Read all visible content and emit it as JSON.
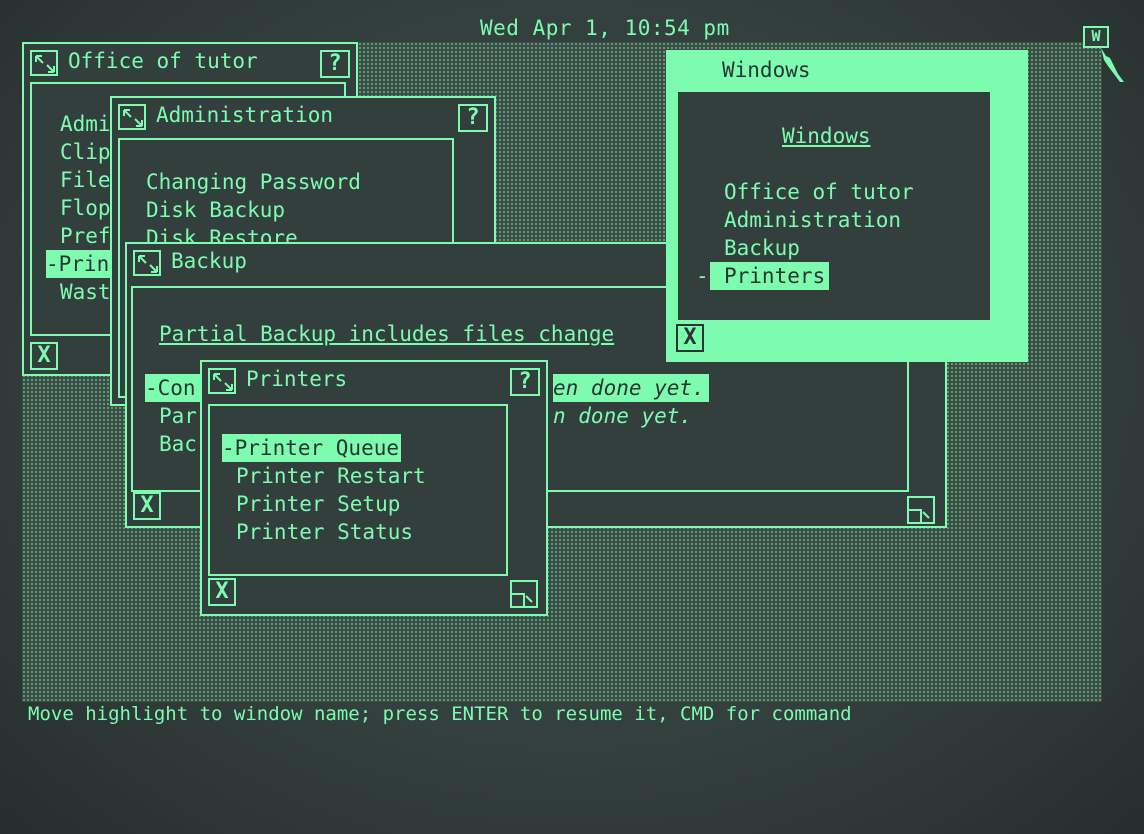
{
  "clock": "Wed Apr 1, 10:54 pm",
  "app_icon": "W",
  "status_line": "Move highlight to window name; press ENTER to resume it, CMD for command",
  "windows": {
    "office": {
      "title": "Office of tutor",
      "help": "?",
      "close": "X",
      "items": [
        "Admi",
        "Clip",
        "File",
        "Flop",
        "Pref",
        "-Prin",
        "Wast"
      ],
      "selected_index": 5
    },
    "administration": {
      "title": "Administration",
      "help": "?",
      "items": [
        "Changing Password",
        "Disk Backup",
        "Disk Restore"
      ]
    },
    "backup": {
      "title": "Backup",
      "close": "X",
      "heading": "Partial Backup includes files change",
      "items": [
        "-Con",
        "Par",
        "Bac"
      ],
      "items_right": [
        "en done yet.",
        "n done yet."
      ],
      "selected_index": 0
    },
    "printers": {
      "title": "Printers",
      "help": "?",
      "close": "X",
      "items": [
        "-Printer Queue",
        "Printer Restart",
        "Printer Setup",
        "Printer Status"
      ],
      "selected_index": 0
    },
    "windows_menu": {
      "title": "Windows",
      "heading": "Windows",
      "close": "X",
      "items": [
        "Office of tutor",
        "Administration",
        "Backup",
        "Printers"
      ],
      "selected_index": 3,
      "selected_marker": "-"
    }
  },
  "colors": {
    "phosphor": "#7dfcb0",
    "background": "#333f3d"
  }
}
